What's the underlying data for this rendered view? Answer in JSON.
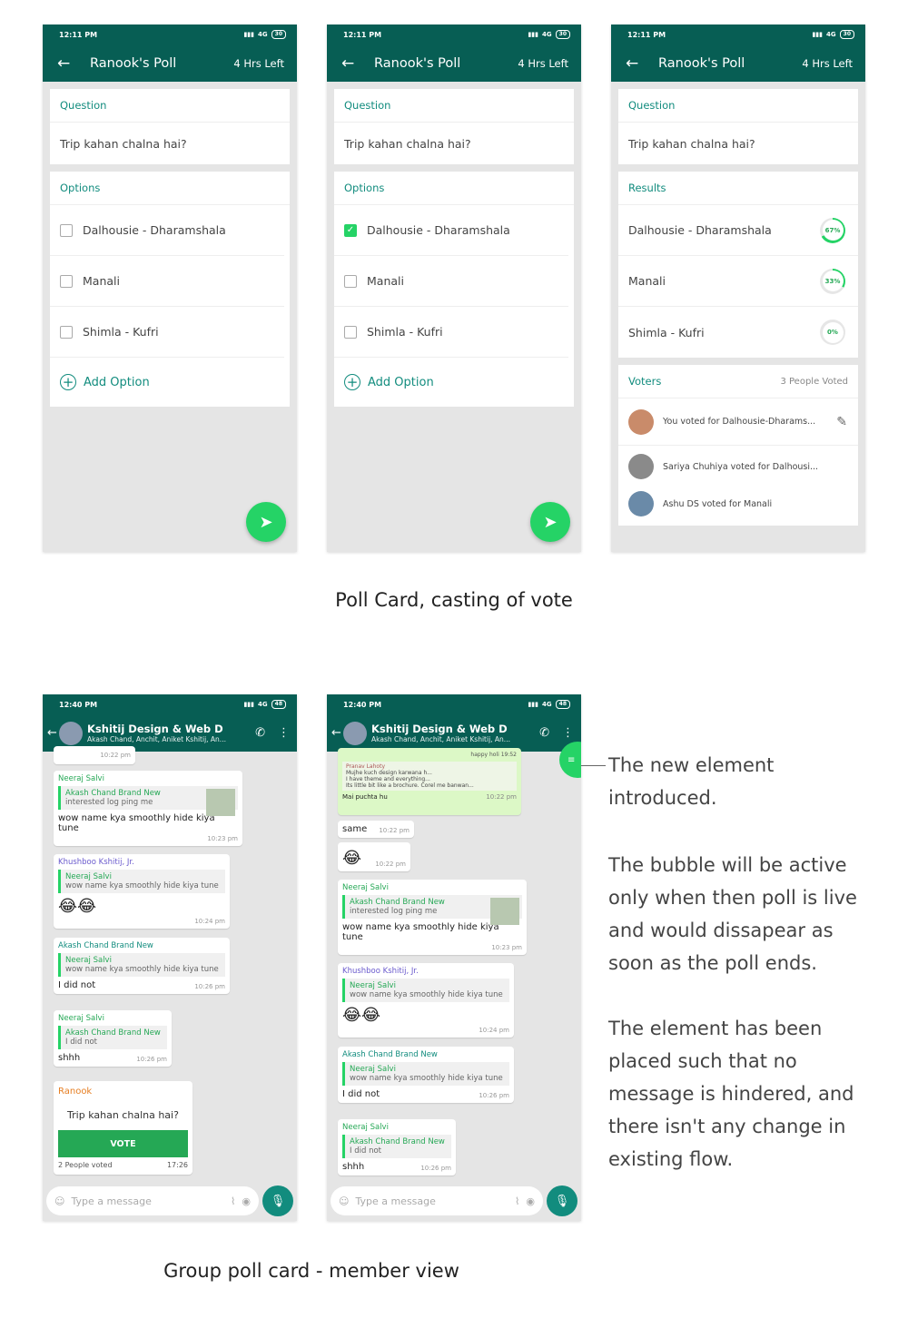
{
  "status": {
    "time": "12:11 PM",
    "signal": "4G",
    "battery": "30"
  },
  "poll": {
    "title": "Ranook's Poll",
    "time_left": "4 Hrs Left",
    "question_label": "Question",
    "question": "Trip kahan chalna hai?",
    "options_label": "Options",
    "results_label": "Results",
    "options": [
      "Dalhousie - Dharamshala",
      "Manali",
      "Shimla - Kufri"
    ],
    "add_option": "Add Option",
    "results": [
      {
        "label": "Dalhousie - Dharamshala",
        "pct": "67%",
        "fraction": 0.67
      },
      {
        "label": "Manali",
        "pct": "33%",
        "fraction": 0.33
      },
      {
        "label": "Shimla - Kufri",
        "pct": "0%",
        "fraction": 0
      }
    ],
    "voters_label": "Voters",
    "voters_count": "3 People Voted",
    "voters": [
      "You voted for Dalhousie-Dharams...",
      "Sariya Chuhiya voted for Dalhousi...",
      "Ashu DS voted for Manali"
    ]
  },
  "caption1": "Poll Card, casting of vote",
  "chat": {
    "status_time": "12:40 PM",
    "battery": "48",
    "group_name": "Kshitij Design & Web D",
    "members": "Akash Chand, Anchit, Aniket Kshitij, An...",
    "input_placeholder": "Type a message",
    "m1_time": "10:22 pm",
    "m2": {
      "sender": "Neeraj Salvi",
      "quote_name": "Akash Chand Brand New",
      "quote_text": "interested log ping me",
      "text": "wow name kya smoothly hide kiya tune",
      "time": "10:23 pm"
    },
    "m3": {
      "sender": "Khushboo Kshitij, Jr.",
      "quote_name": "Neeraj Salvi",
      "quote_text": "wow name kya smoothly hide kiya tune",
      "time": "10:24 pm"
    },
    "m4": {
      "sender": "Akash Chand Brand New",
      "quote_name": "Neeraj Salvi",
      "quote_text": "wow name kya smoothly hide kiya tune",
      "text": "I did not",
      "time": "10:26 pm"
    },
    "m5": {
      "sender": "Neeraj Salvi",
      "quote_name": "Akash Chand Brand New",
      "quote_text": "I did not",
      "text": "shhh",
      "time": "10:26 pm"
    },
    "pollcard": {
      "sender": "Ranook",
      "question": "Trip kahan chalna hai?",
      "vote": "VOTE",
      "voted": "2 People voted",
      "time": "17:26"
    },
    "img_msg": {
      "sender": "Pranav Lahoty",
      "line1": "Mujhe kuch design karwana h...",
      "line2": "I have theme and everything...",
      "line3": "Its little bit like a brochure. Corel me banwan...",
      "caption": "Mai puchta hu",
      "time": "10:22 pm",
      "top": "happy holi",
      "toptime": "19:52"
    },
    "same": {
      "text": "same",
      "time": "10:22 pm"
    },
    "emoji_time": "10:22 pm"
  },
  "caption2": "Group poll card - member view",
  "note": {
    "p1": "The new element introduced.",
    "p2": "The bubble will be active only when then poll is live and would dissapear as soon as the poll ends.",
    "p3": "The element has been placed such that no message is hindered, and there isn't any change in existing flow."
  },
  "colors": {
    "primary": "#075e54",
    "accent": "#25d366",
    "teal": "#128c7e"
  }
}
